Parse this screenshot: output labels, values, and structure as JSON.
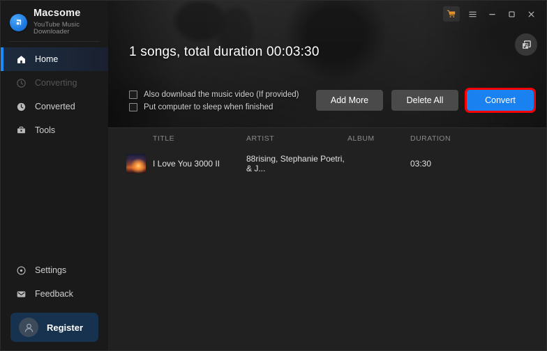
{
  "brand": {
    "name": "Macsome",
    "subtitle": "YouTube Music Downloader",
    "logo_icon": "macsome-logo-icon"
  },
  "sidebar": {
    "items": [
      {
        "label": "Home",
        "icon": "home-icon",
        "state": "active"
      },
      {
        "label": "Converting",
        "icon": "converting-icon",
        "state": "disabled"
      },
      {
        "label": "Converted",
        "icon": "clock-icon",
        "state": "normal"
      },
      {
        "label": "Tools",
        "icon": "toolbox-icon",
        "state": "normal"
      }
    ],
    "bottom_items": [
      {
        "label": "Settings",
        "icon": "gear-icon"
      },
      {
        "label": "Feedback",
        "icon": "feedback-icon"
      }
    ],
    "register": {
      "label": "Register",
      "icon": "user-avatar-icon"
    }
  },
  "titlebar": {
    "cart_icon": "shopping-cart-icon",
    "menu_icon": "hamburger-menu-icon",
    "minimize_icon": "minimize-icon",
    "maximize_icon": "maximize-icon",
    "close_icon": "close-icon"
  },
  "hero": {
    "summary": "1 songs, total duration 00:03:30",
    "library_button_icon": "music-library-icon",
    "options": [
      {
        "label": "Also download the music video (If provided)",
        "checked": false
      },
      {
        "label": "Put computer to sleep when finished",
        "checked": false
      }
    ],
    "buttons": {
      "add_more": "Add More",
      "delete_all": "Delete All",
      "convert": "Convert"
    }
  },
  "table": {
    "headers": {
      "title": "TITLE",
      "artist": "ARTIST",
      "album": "ALBUM",
      "duration": "DURATION"
    },
    "rows": [
      {
        "title": "I Love You 3000 II",
        "artist": "88rising, Stephanie Poetri, & J...",
        "album": "",
        "duration": "03:30"
      }
    ]
  },
  "colors": {
    "accent_blue": "#1a8cff",
    "convert_blue": "#1a82f0",
    "highlight_red": "#ff0000",
    "cart_orange": "#e8922a",
    "sidebar_bg": "#1a1a1a",
    "main_bg": "#212121",
    "register_bg": "#17324f"
  }
}
